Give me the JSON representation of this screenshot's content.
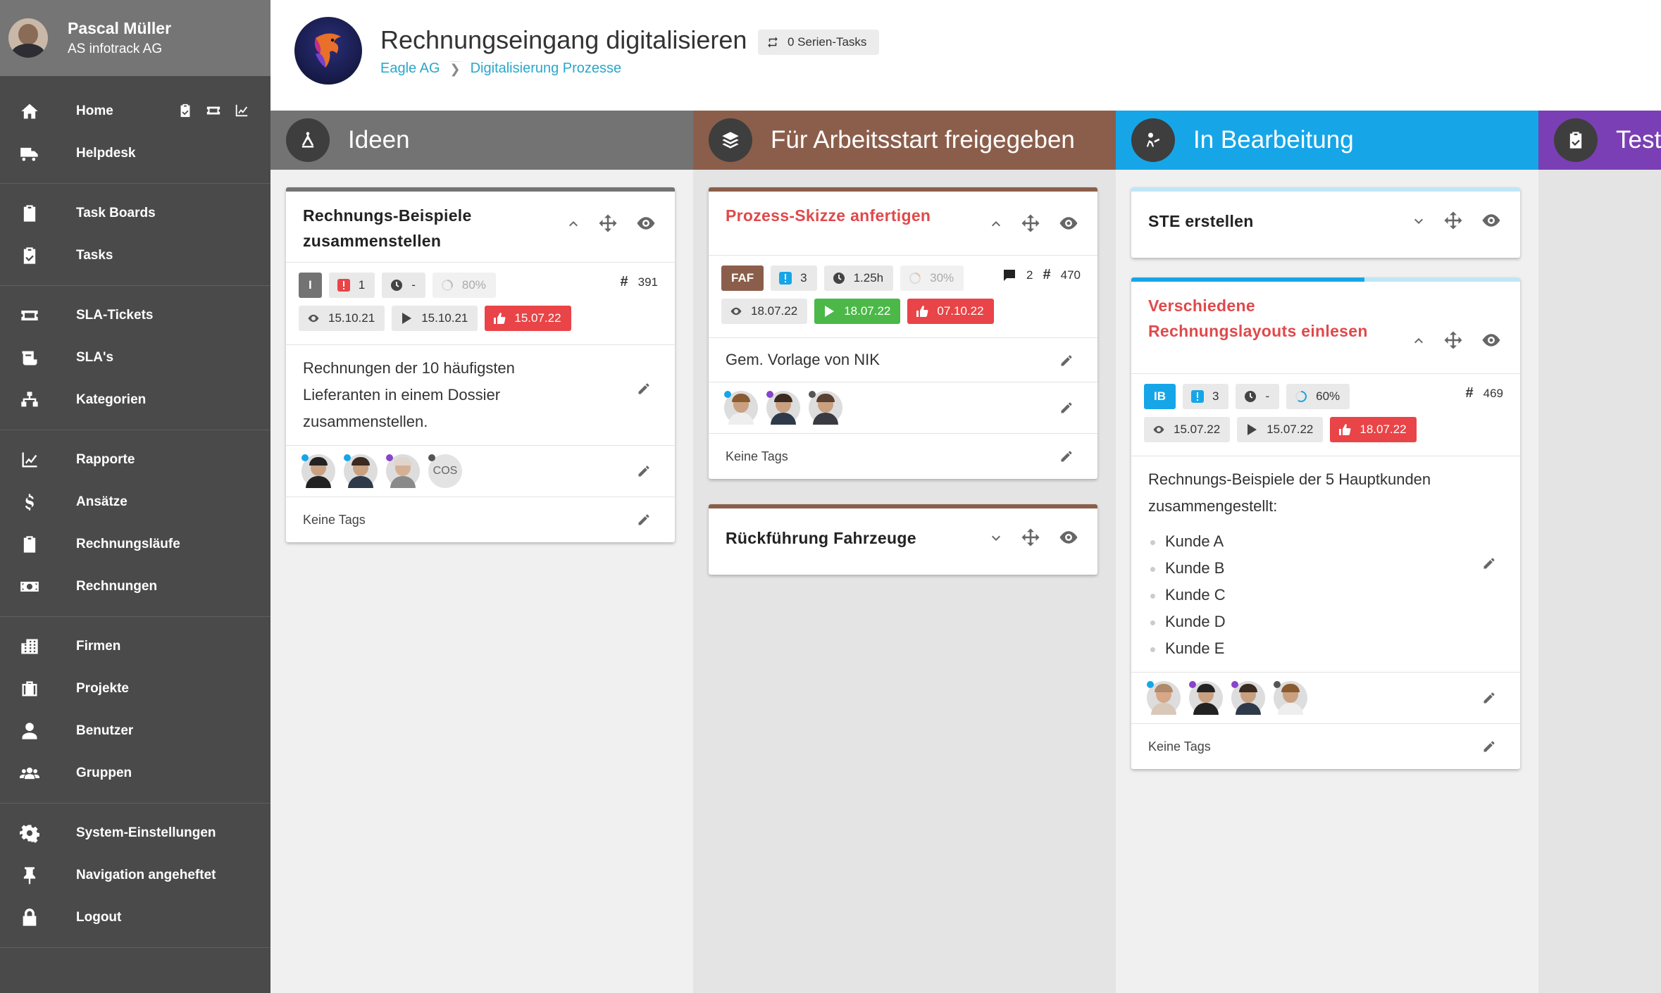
{
  "user": {
    "name": "Pascal Müller",
    "company": "AS infotrack AG"
  },
  "nav": {
    "groups": [
      [
        {
          "label": "Home",
          "icon": "home-icon",
          "name": "home"
        },
        {
          "label": "Helpdesk",
          "icon": "truck-icon",
          "name": "helpdesk"
        }
      ],
      [
        {
          "label": "Task Boards",
          "icon": "clipboard-icon",
          "name": "task-boards"
        },
        {
          "label": "Tasks",
          "icon": "clipboard-check-icon",
          "name": "tasks"
        }
      ],
      [
        {
          "label": "SLA-Tickets",
          "icon": "ticket-icon",
          "name": "sla-tickets"
        },
        {
          "label": "SLA's",
          "icon": "contract-icon",
          "name": "slas"
        },
        {
          "label": "Kategorien",
          "icon": "sitemap-icon",
          "name": "kategorien"
        }
      ],
      [
        {
          "label": "Rapporte",
          "icon": "chart-edit-icon",
          "name": "rapporte"
        },
        {
          "label": "Ansätze",
          "icon": "dollar-icon",
          "name": "ansaetze"
        },
        {
          "label": "Rechnungsläufe",
          "icon": "list-clipboard-icon",
          "name": "rechnungslaeufe"
        },
        {
          "label": "Rechnungen",
          "icon": "money-icon",
          "name": "rechnungen"
        }
      ],
      [
        {
          "label": "Firmen",
          "icon": "building-icon",
          "name": "firmen"
        },
        {
          "label": "Projekte",
          "icon": "briefcase-icon",
          "name": "projekte"
        },
        {
          "label": "Benutzer",
          "icon": "user-icon",
          "name": "benutzer"
        },
        {
          "label": "Gruppen",
          "icon": "users-icon",
          "name": "gruppen"
        }
      ],
      [
        {
          "label": "System-Einstellungen",
          "icon": "gear-icon",
          "name": "system-einstellungen"
        },
        {
          "label": "Navigation angeheftet",
          "icon": "pin-icon",
          "name": "navigation-angeheftet"
        },
        {
          "label": "Logout",
          "icon": "lock-icon",
          "name": "logout"
        }
      ]
    ]
  },
  "project": {
    "title": "Rechnungseingang digitalisieren",
    "serien": "0 Serien-Tasks",
    "breadcrumb": [
      "Eagle AG",
      "Digitalisierung Prozesse"
    ]
  },
  "columns": [
    {
      "title": "Ideen",
      "color": "#737373",
      "bg": "#f0f0f0"
    },
    {
      "title": "Für Arbeitsstart freigegeben",
      "color": "#8b5e4b",
      "bg": "#e4e4e4"
    },
    {
      "title": "In Bearbeitung",
      "color": "#16a6e8",
      "bg": "#f0f0f0"
    },
    {
      "title": "Test",
      "color": "#7a3fb4",
      "bg": "#e4e4e4"
    }
  ],
  "cards": {
    "c1": {
      "title_l1": "Rechnungs-Beispiele",
      "title_l2": "zusammenstellen",
      "status": "I",
      "prio": "1",
      "time": "-",
      "progress": "80%",
      "id": "391",
      "seen": "15.10.21",
      "start": "15.10.21",
      "due": "15.07.22",
      "desc_l1": "Rechnungen der 10 häufigsten",
      "desc_l2": "Lieferanten in einem Dossier",
      "desc_l3": "zusammenstellen.",
      "extra_avatar": "COS",
      "tags": "Keine Tags"
    },
    "c2": {
      "title": "Prozess-Skizze anfertigen",
      "status": "FAF",
      "prio": "3",
      "time": "1.25h",
      "progress": "30%",
      "comments": "2",
      "id": "470",
      "seen": "18.07.22",
      "start": "18.07.22",
      "due": "07.10.22",
      "desc": "Gem. Vorlage von NIK",
      "tags": "Keine Tags"
    },
    "c3": {
      "title": "Rückführung Fahrzeuge"
    },
    "c4": {
      "title": "STE erstellen"
    },
    "c5": {
      "title_l1": "Verschiedene",
      "title_l2": "Rechnungslayouts einlesen",
      "status": "IB",
      "prio": "3",
      "time": "-",
      "progress": "60%",
      "id": "469",
      "seen": "15.07.22",
      "start": "15.07.22",
      "due": "18.07.22",
      "desc_l1": "Rechnungs-Beispiele der 5 Hauptkunden",
      "desc_l2": "zusammengestellt:",
      "list": [
        "Kunde A",
        "Kunde B",
        "Kunde C",
        "Kunde D",
        "Kunde E"
      ],
      "tags": "Keine Tags"
    }
  }
}
